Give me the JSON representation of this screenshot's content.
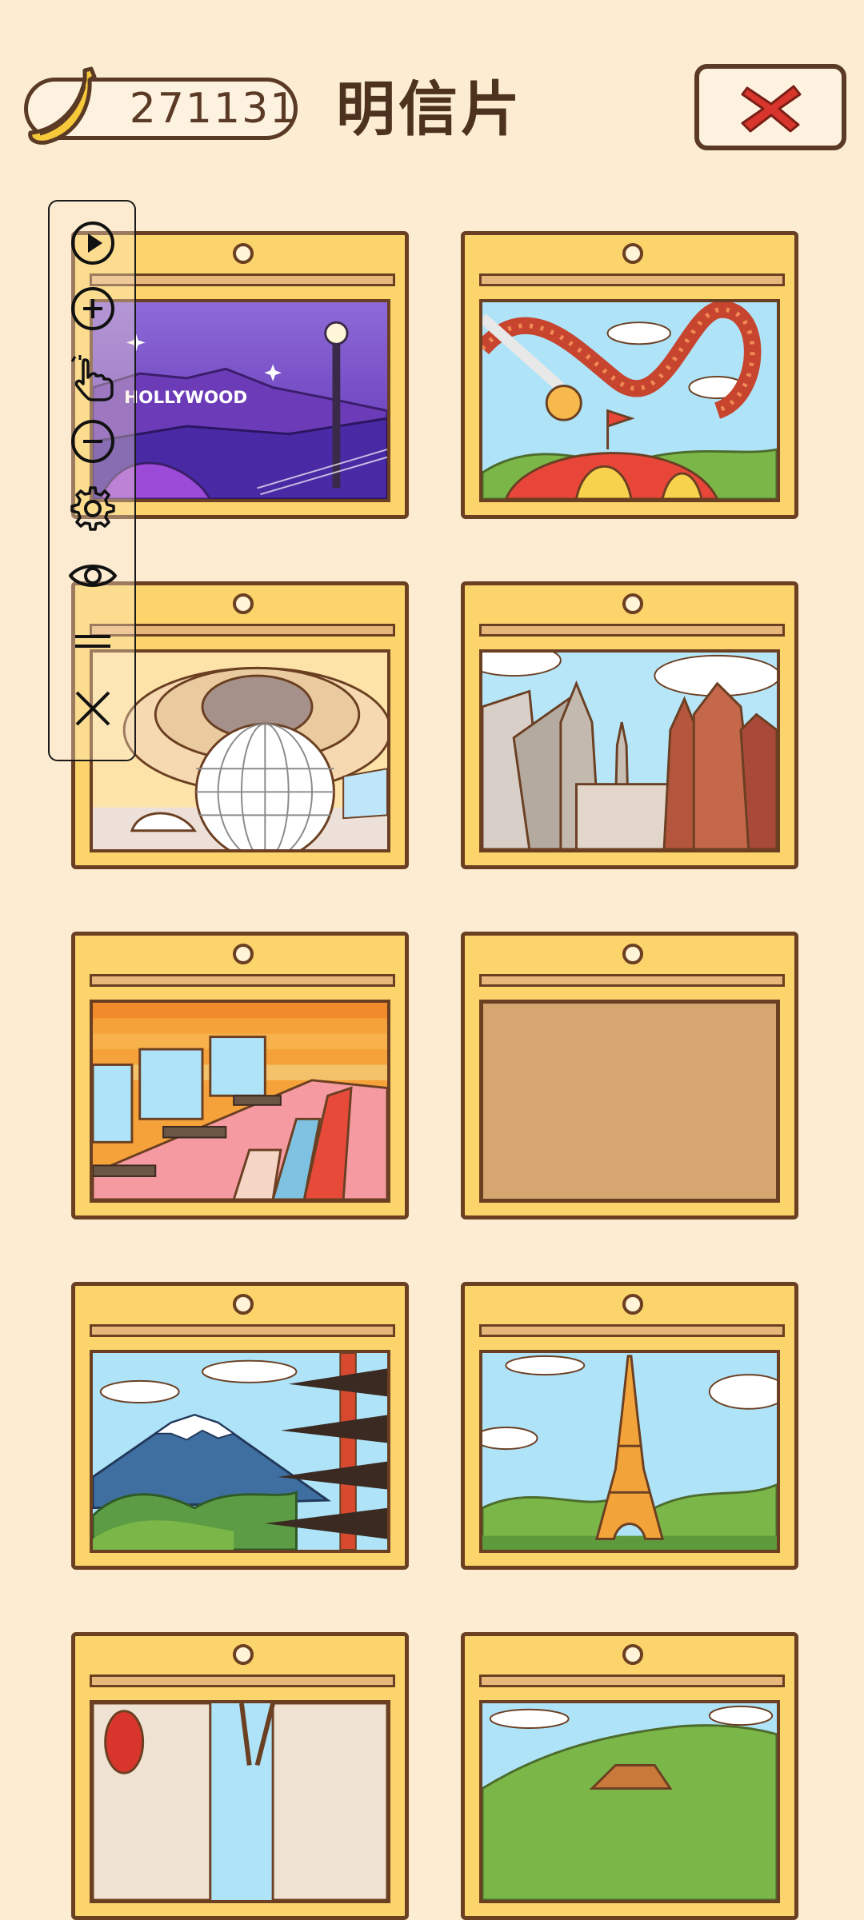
{
  "header": {
    "coins": "271131",
    "title": "明信片"
  },
  "postcards": [
    {
      "name": "Hollywood",
      "sign_text": "HOLLYWOOD"
    },
    {
      "name": "Amusement park"
    },
    {
      "name": "Sphere dome"
    },
    {
      "name": "City skyscrapers"
    },
    {
      "name": "Internet cafe"
    },
    {
      "name": "Locked"
    },
    {
      "name": "Mount Fuji pagoda"
    },
    {
      "name": "Eiffel Tower"
    },
    {
      "name": "Old street"
    },
    {
      "name": "Countryside"
    }
  ],
  "toolbar": {
    "items": [
      "play-icon",
      "zoom-in-icon",
      "hand-pointer-icon",
      "zoom-out-icon",
      "gear-icon",
      "eye-icon",
      "menu-icon",
      "close-icon"
    ]
  },
  "colors": {
    "background": "#fcecd2",
    "card_frame": "#fcd46c",
    "outline": "#6b3f22",
    "close_x": "#d8362c",
    "locked": "#d5a66f"
  }
}
